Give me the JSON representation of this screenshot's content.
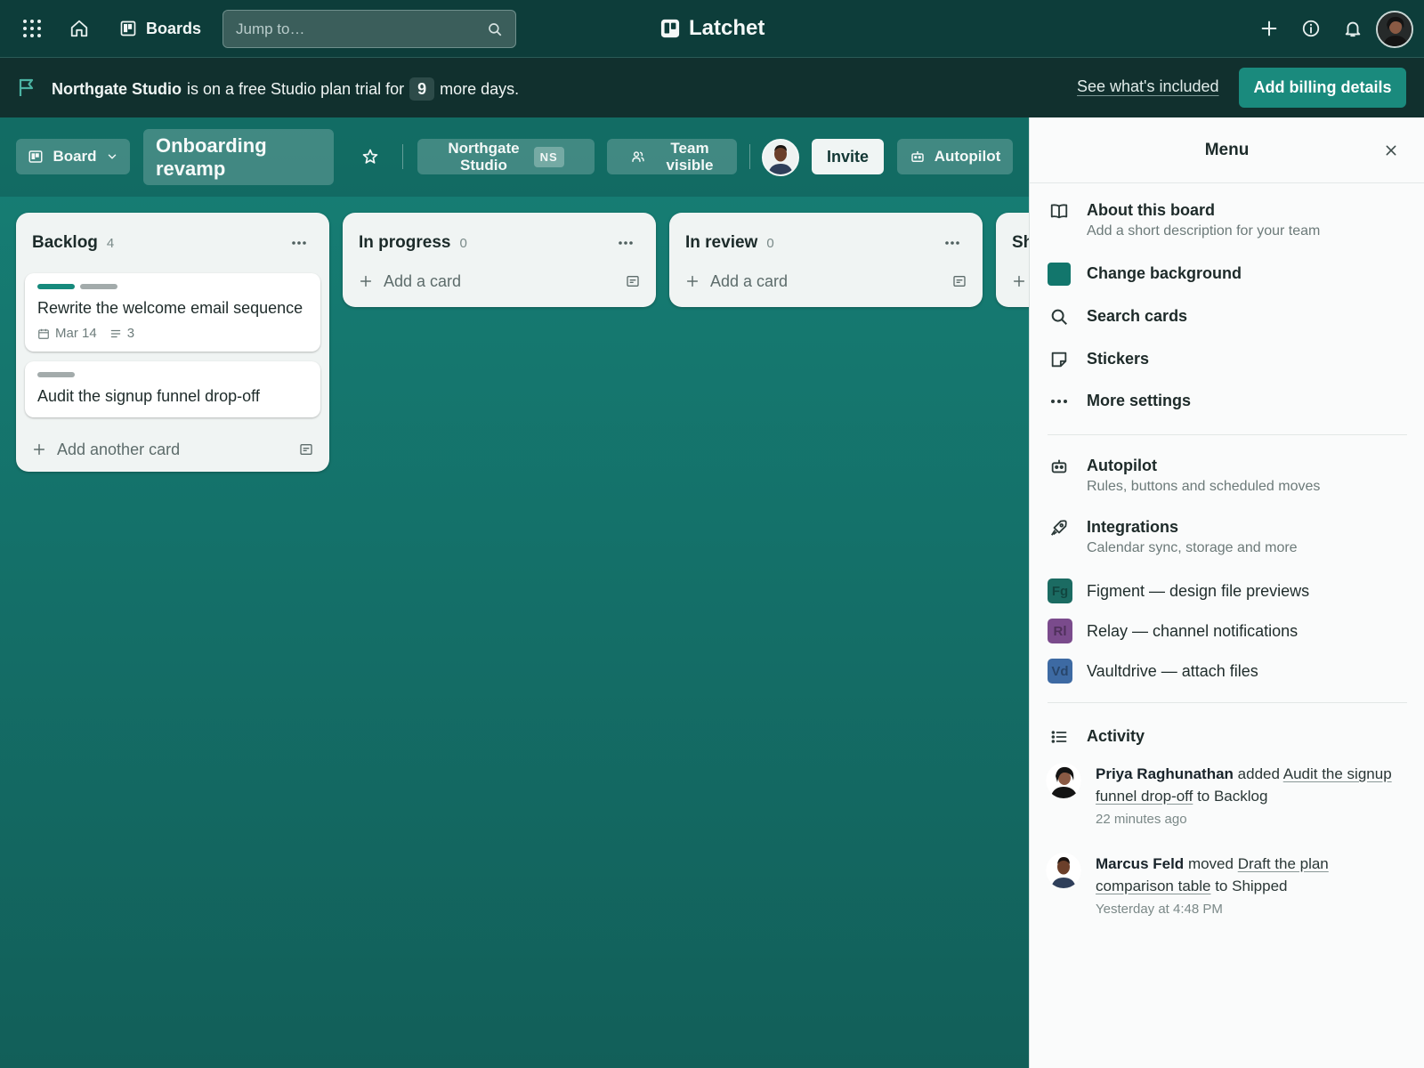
{
  "topbar": {
    "apps_icon": "grid-icon",
    "home_icon": "home-icon",
    "boards_label": "Boards",
    "search_placeholder": "Jump to…",
    "brand_name": "Latchet",
    "create_icon": "plus-icon",
    "info_icon": "info-icon",
    "notifications_icon": "bell-icon"
  },
  "banner": {
    "workspace": "Northgate Studio",
    "text_before": "is on a free Studio plan trial for",
    "days": "9",
    "text_after": "more days.",
    "see_link": "See what's included",
    "billing_button": "Add billing details"
  },
  "board_header": {
    "view_label": "Board",
    "title_line1": "Onboarding",
    "title_line2": "revamp",
    "workspace_line1": "Northgate",
    "workspace_line2": "Studio",
    "workspace_badge": "NS",
    "visibility_line1": "Team",
    "visibility_line2": "visible",
    "invite_label": "Invite",
    "autopilot_label": "Autopilot"
  },
  "lists": [
    {
      "title": "Backlog",
      "count": "4",
      "cards": [
        {
          "title": "Rewrite the welcome email sequence",
          "due": "Mar 14",
          "checklist": "3",
          "labels": [
            "#168a7c",
            "#a3abab"
          ]
        },
        {
          "title": "Audit the signup funnel drop-off",
          "labels": [
            "#a3abab"
          ]
        }
      ],
      "add_label": "Add another card"
    },
    {
      "title": "In progress",
      "count": "0",
      "add_label": "Add a card"
    },
    {
      "title": "In review",
      "count": "0",
      "add_label": "Add a card"
    },
    {
      "title": "Sh"
    }
  ],
  "menu": {
    "title": "Menu",
    "about_title": "About this board",
    "about_sub": "Add a short description for your team",
    "background_title": "Change background",
    "background_color": "#12766c",
    "search_title": "Search cards",
    "stickers_title": "Stickers",
    "more_title": "More settings",
    "autopilot_title": "Autopilot",
    "autopilot_sub": "Rules, buttons and scheduled moves",
    "integrations_title": "Integrations",
    "integrations_sub": "Calendar sync, storage and more",
    "integrations": [
      {
        "abbr": "Fg",
        "name": "Figment — design file previews",
        "color": "#1b6b62"
      },
      {
        "abbr": "Rl",
        "name": "Relay — channel notifications",
        "color": "#7a4b8c"
      },
      {
        "abbr": "Vd",
        "name": "Vaultdrive — attach files",
        "color": "#3d6aa3"
      }
    ],
    "activity_title": "Activity",
    "activity": [
      {
        "user": "Priya Raghunathan",
        "verb": "added",
        "link_a": "Audit the signup",
        "link_b": "funnel drop-off",
        "suffix": "to Backlog",
        "time": "22 minutes ago"
      },
      {
        "user": "Marcus Feld",
        "verb": "moved",
        "link_a": "Draft the plan",
        "link_b": "comparison table",
        "suffix": "to Shipped",
        "time": "Yesterday at 4:48 PM"
      }
    ]
  }
}
